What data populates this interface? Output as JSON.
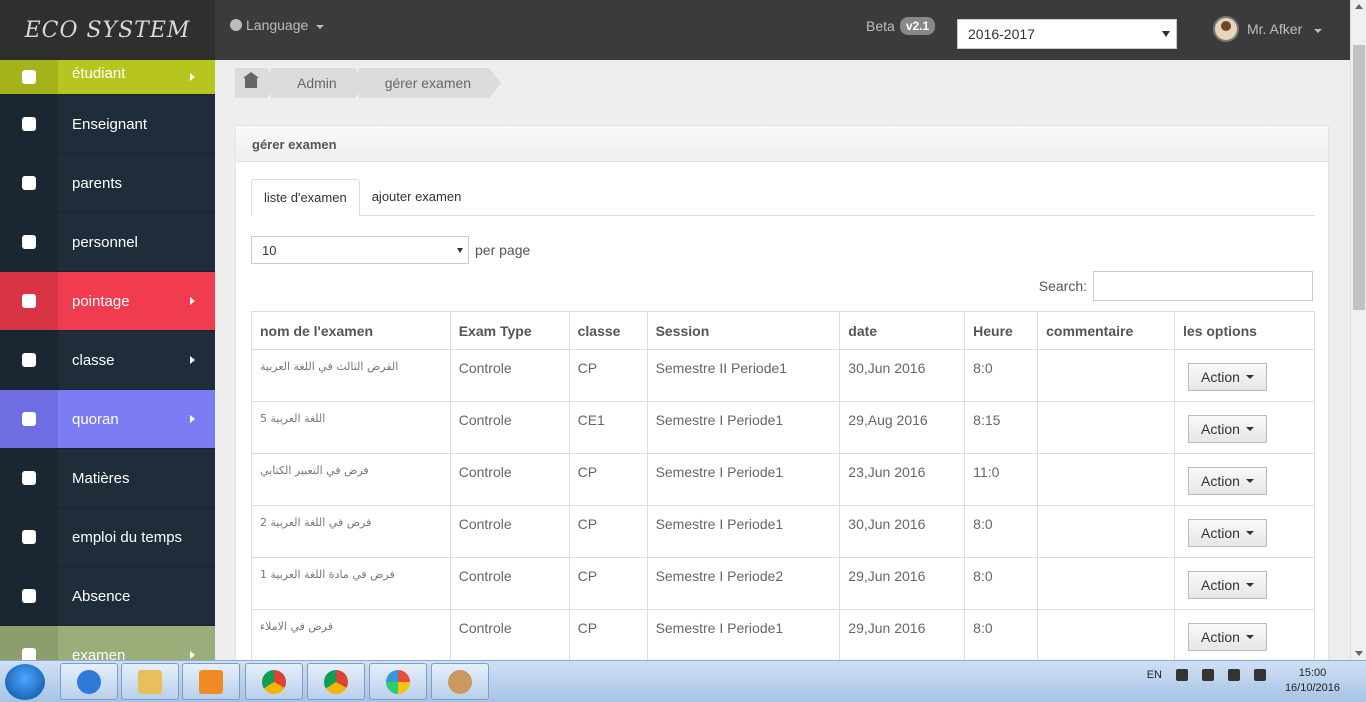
{
  "brand": "ECO SYSTEM",
  "language_label": "Language",
  "beta_label": "Beta",
  "version": "v2.1",
  "year_select": "2016-2017",
  "user_name": "Mr. Afker",
  "sidebar": [
    {
      "label": "étudiant",
      "icon": "users-icon",
      "color": "#b7c51f",
      "iconbg": "#a4b31a",
      "chevron": true
    },
    {
      "label": "Enseignant",
      "icon": "user-icon",
      "color": "#1f2d3a",
      "iconbg": "#1a2632",
      "chevron": false
    },
    {
      "label": "parents",
      "icon": "user-icon",
      "color": "#1f2d3a",
      "iconbg": "#1a2632",
      "chevron": false
    },
    {
      "label": "personnel",
      "icon": "users-icon",
      "color": "#1f2d3a",
      "iconbg": "#1a2632",
      "chevron": false
    },
    {
      "label": "pointage",
      "icon": "clock-icon",
      "color": "#f03c4e",
      "iconbg": "#d93444",
      "chevron": true
    },
    {
      "label": "classe",
      "icon": "briefcase-icon",
      "color": "#1f2d3a",
      "iconbg": "#1a2632",
      "chevron": true
    },
    {
      "label": "quoran",
      "icon": "trophy-icon",
      "color": "#7c7cf5",
      "iconbg": "#6e6ee2",
      "chevron": true
    },
    {
      "label": "Matières",
      "icon": "book-icon",
      "color": "#1f2d3a",
      "iconbg": "#1a2632",
      "chevron": false
    },
    {
      "label": "emploi du temps",
      "icon": "clock-icon",
      "color": "#1f2d3a",
      "iconbg": "#1a2632",
      "chevron": false
    },
    {
      "label": "Absence",
      "icon": "rss-icon",
      "color": "#1f2d3a",
      "iconbg": "#1a2632",
      "chevron": false
    },
    {
      "label": "examen",
      "icon": "bar-chart-icon",
      "color": "#9bae7a",
      "iconbg": "#8c9e6c",
      "chevron": true
    }
  ],
  "breadcrumb": [
    "Admin",
    "gérer examen"
  ],
  "panel_title": "gérer examen",
  "tabs": [
    "liste d'examen",
    "ajouter examen"
  ],
  "per_page_value": "10",
  "per_page_label": "per page",
  "search_label": "Search:",
  "columns": [
    "nom de l'examen",
    "Exam Type",
    "classe",
    "Session",
    "date",
    "Heure",
    "commentaire",
    "les options"
  ],
  "rows": [
    [
      "الفرض الثالث في اللغة العربية",
      "Controle",
      "CP",
      "Semestre II Periode1",
      "30,Jun 2016",
      "8:0",
      "",
      "Action"
    ],
    [
      "اللغة العربية 5",
      "Controle",
      "CE1",
      "Semestre I Periode1",
      "29,Aug 2016",
      "8:15",
      "",
      "Action"
    ],
    [
      "فرض في التعبير الكتابي",
      "Controle",
      "CP",
      "Semestre I Periode1",
      "23,Jun 2016",
      "11:0",
      "",
      "Action"
    ],
    [
      "فرض في اللغة العربية 2",
      "Controle",
      "CP",
      "Semestre I Periode1",
      "30,Jun 2016",
      "8:0",
      "",
      "Action"
    ],
    [
      "فرض في مادة اللغة العربية 1",
      "Controle",
      "CP",
      "Semestre I Periode2",
      "29,Jun 2016",
      "8:0",
      "",
      "Action"
    ],
    [
      "فرض في الاملاء",
      "Controle",
      "CP",
      "Semestre I Periode1",
      "29,Jun 2016",
      "8:0",
      "",
      "Action"
    ]
  ],
  "taskbar": {
    "lang": "EN",
    "time": "15:00",
    "date": "16/10/2016"
  }
}
